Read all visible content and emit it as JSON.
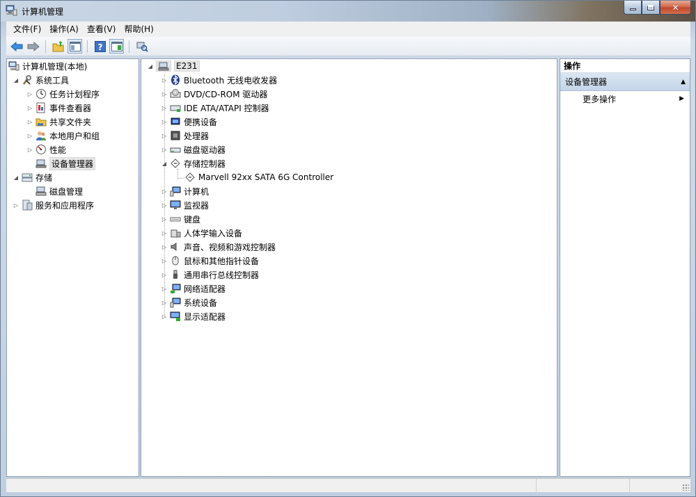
{
  "window": {
    "title": "计算机管理",
    "controls": {
      "minimize": "minimize-icon",
      "maximize": "maximize-icon",
      "close": "close-icon"
    }
  },
  "menubar": {
    "items": [
      "文件(F)",
      "操作(A)",
      "查看(V)",
      "帮助(H)"
    ]
  },
  "toolbar": {
    "buttons": [
      "back-arrow-icon",
      "forward-arrow-icon",
      "up-folder-icon",
      "show-hide-tree-icon",
      "help-icon",
      "show-hide-action-pane-icon",
      "device-scan-icon"
    ]
  },
  "left_tree": {
    "root": "计算机管理(本地)",
    "system_tools": "系统工具",
    "task_scheduler": "任务计划程序",
    "event_viewer": "事件查看器",
    "shared_folders": "共享文件夹",
    "local_users": "本地用户和组",
    "performance": "性能",
    "device_manager": "设备管理器",
    "storage": "存储",
    "disk_management": "磁盘管理",
    "services_apps": "服务和应用程序"
  },
  "device_tree": {
    "computer_name": "E231",
    "categories": [
      {
        "label": "Bluetooth 无线电收发器",
        "icon": "bluetooth-icon"
      },
      {
        "label": "DVD/CD-ROM 驱动器",
        "icon": "optical-drive-icon"
      },
      {
        "label": "IDE ATA/ATAPI 控制器",
        "icon": "ide-controller-icon"
      },
      {
        "label": "便携设备",
        "icon": "portable-device-icon"
      },
      {
        "label": "处理器",
        "icon": "processor-icon"
      },
      {
        "label": "磁盘驱动器",
        "icon": "disk-drive-icon"
      },
      {
        "label": "存储控制器",
        "icon": "storage-controller-icon"
      },
      {
        "label": "计算机",
        "icon": "computer-icon"
      },
      {
        "label": "监视器",
        "icon": "monitor-icon"
      },
      {
        "label": "键盘",
        "icon": "keyboard-icon"
      },
      {
        "label": "人体学输入设备",
        "icon": "hid-icon"
      },
      {
        "label": "声音、视频和游戏控制器",
        "icon": "sound-icon"
      },
      {
        "label": "鼠标和其他指针设备",
        "icon": "mouse-icon"
      },
      {
        "label": "通用串行总线控制器",
        "icon": "usb-icon"
      },
      {
        "label": "网络适配器",
        "icon": "network-adapter-icon"
      },
      {
        "label": "系统设备",
        "icon": "system-device-icon"
      },
      {
        "label": "显示适配器",
        "icon": "display-adapter-icon"
      }
    ],
    "storage_child": "Marvell 92xx SATA 6G Controller"
  },
  "actions": {
    "header": "操作",
    "section": "设备管理器",
    "more": "更多操作"
  }
}
